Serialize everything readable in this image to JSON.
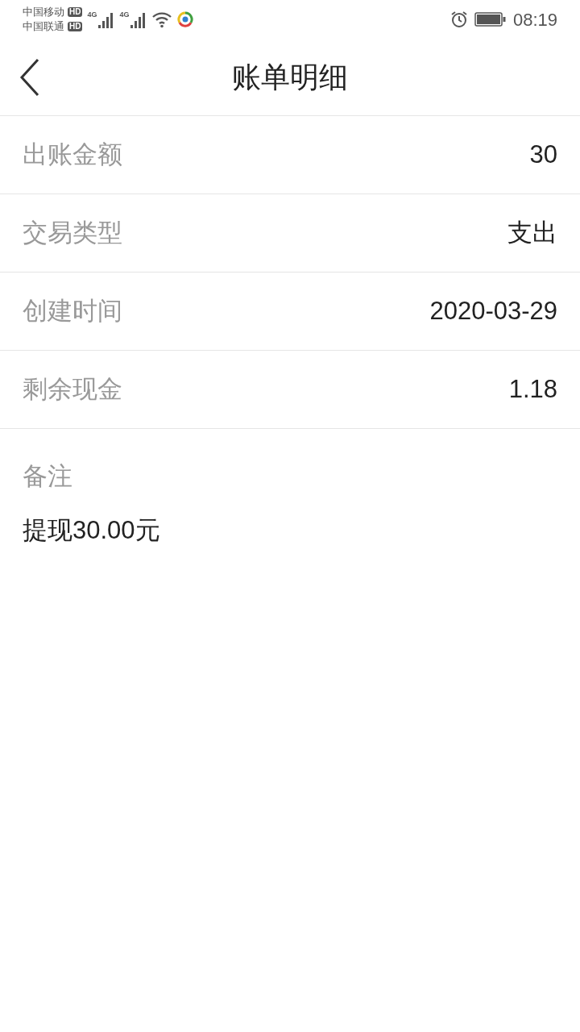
{
  "status_bar": {
    "carriers": [
      {
        "name": "中国移动",
        "badge": "HD"
      },
      {
        "name": "中国联通",
        "badge": "HD"
      }
    ],
    "network_labels": [
      "4G",
      "4G"
    ],
    "time": "08:19"
  },
  "header": {
    "title": "账单明细"
  },
  "rows": [
    {
      "label": "出账金额",
      "value": "30"
    },
    {
      "label": "交易类型",
      "value": "支出"
    },
    {
      "label": "创建时间",
      "value": "2020-03-29"
    },
    {
      "label": "剩余现金",
      "value": "1.18"
    }
  ],
  "note": {
    "label": "备注",
    "text": "提现30.00元"
  }
}
